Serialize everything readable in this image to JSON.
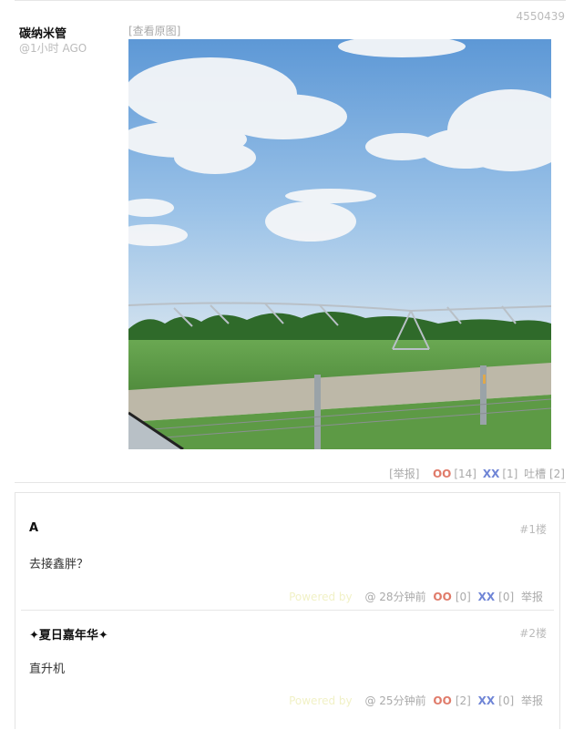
{
  "post": {
    "id": "4550439",
    "author": "碳纳米管",
    "time": "@1小时 AGO",
    "view_original": "[查看原图]",
    "report": "[举报]",
    "oo_icon": "OO",
    "oo_count": "[14]",
    "xx_icon": "XX",
    "xx_count": "[1]",
    "tucao": "吐槽 [2]"
  },
  "comments": [
    {
      "author": "A",
      "floor": "#1楼",
      "text": "去接鑫胖？",
      "tag": "Powered by",
      "time": "@  28分钟前",
      "oo": "OO",
      "oo_count": "[0]",
      "xx": "XX",
      "xx_count": "[0]",
      "report": "举报"
    },
    {
      "author": "✦夏日嘉年华✦",
      "floor": "#2楼",
      "text": "直升机",
      "tag": "Powered by",
      "time": "@  25分钟前",
      "oo": "OO",
      "oo_count": "[2]",
      "xx": "XX",
      "xx_count": "[0]",
      "report": "举报"
    }
  ],
  "colors": {
    "oo": "#e07b6a",
    "xx": "#6f85d6",
    "muted": "#aaaaaa",
    "sky": "#5f9ad8",
    "grass": "#5a9a44"
  }
}
